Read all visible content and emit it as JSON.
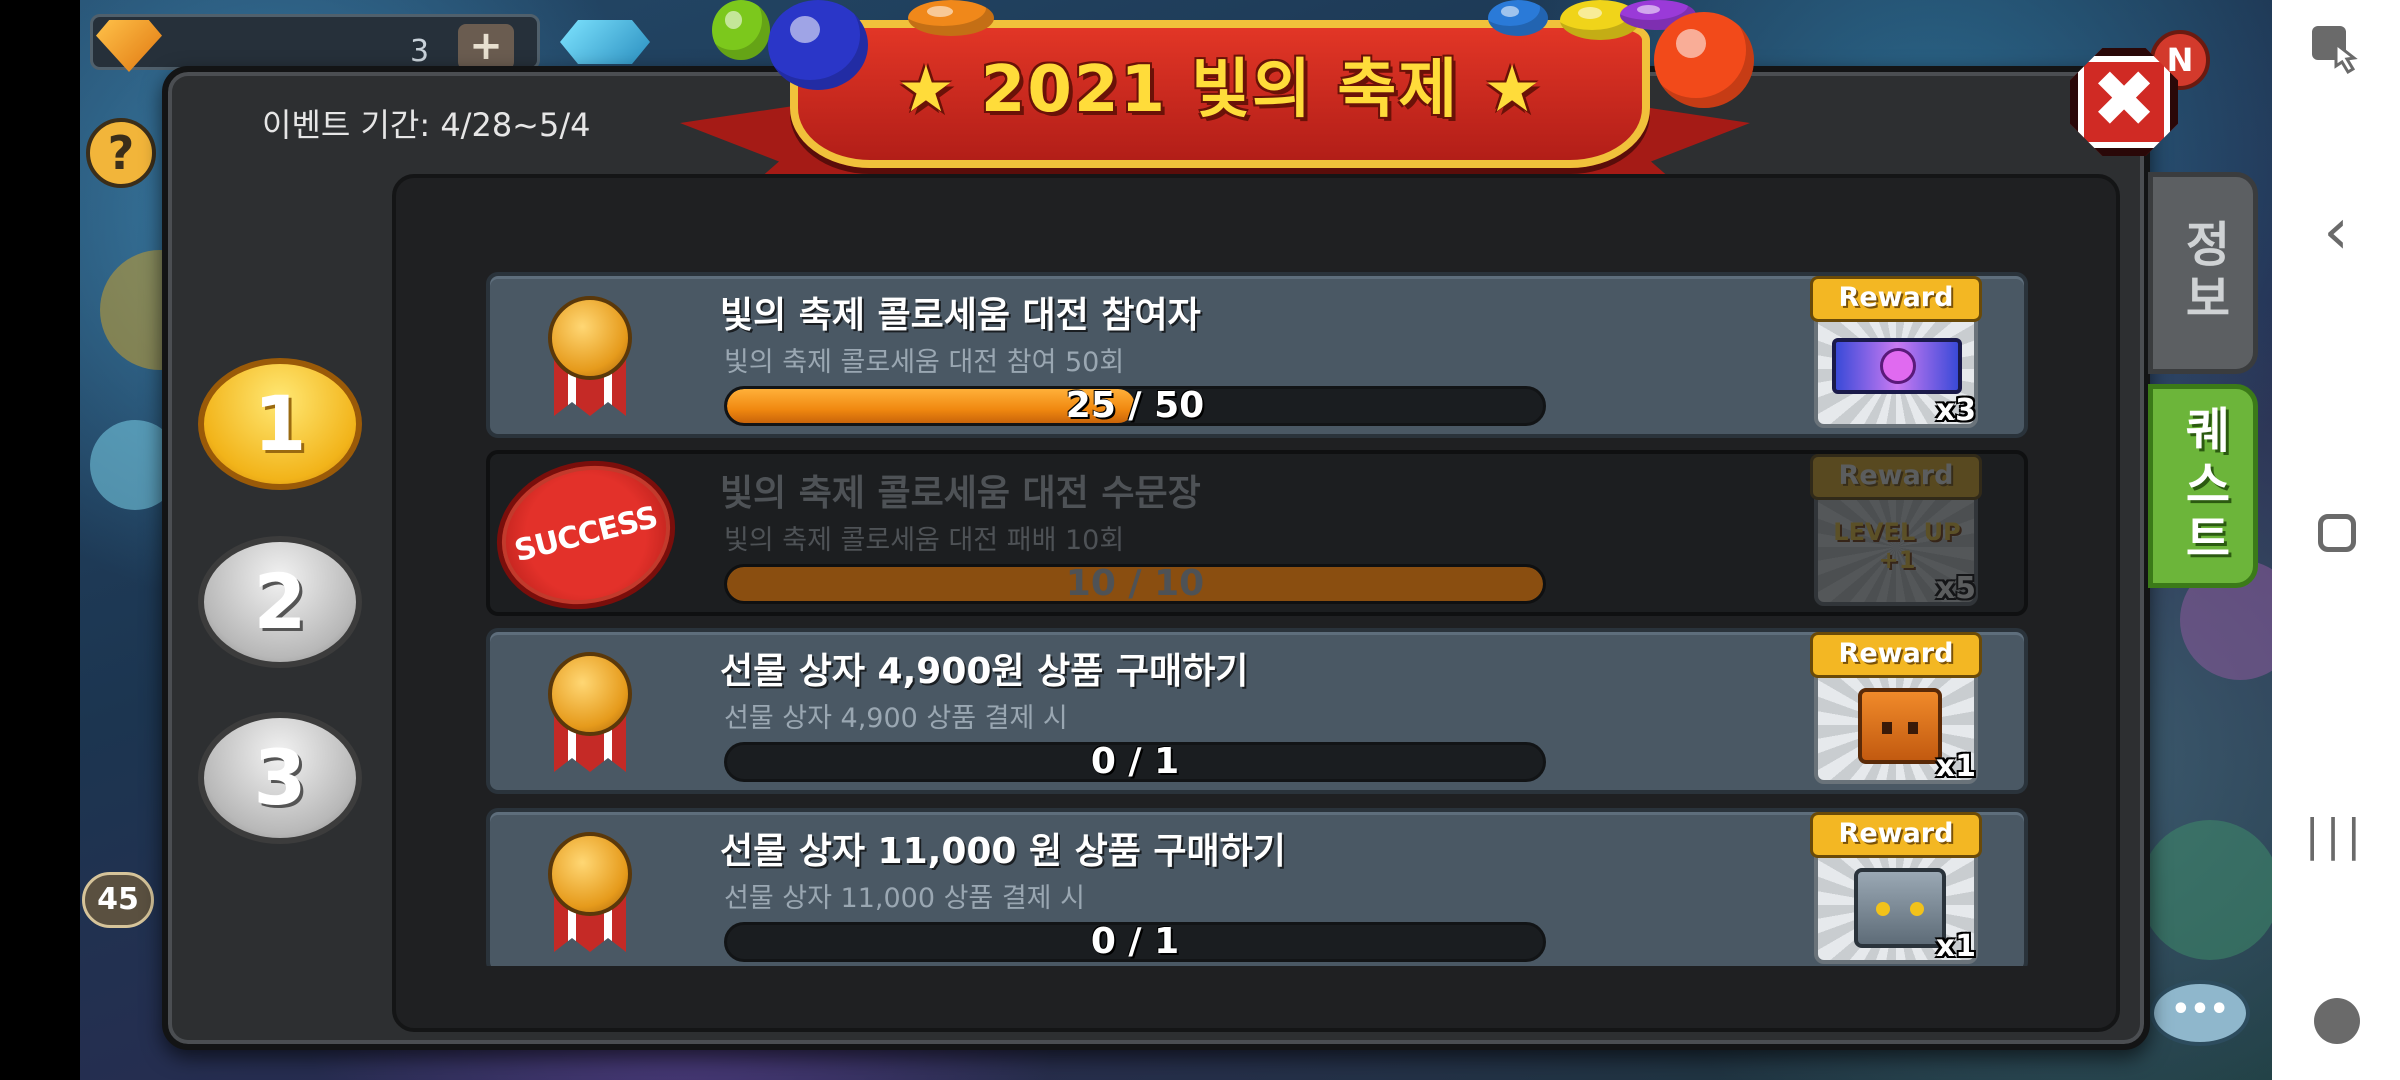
{
  "game": {
    "gem_count": "3",
    "gem_plus": "+",
    "help_symbol": "?",
    "level": "45",
    "notice_badge": "N",
    "chat_symbol": "•••"
  },
  "dialog": {
    "banner_title": "★ 2021 빛의 축제 ★",
    "event_period": "이벤트 기간: 4/28~5/4",
    "close_symbol": "✖",
    "tabs": [
      {
        "label": "정보",
        "active": false
      },
      {
        "label": "퀘스트",
        "active": true
      }
    ],
    "steps": [
      {
        "label": "1",
        "active": true
      },
      {
        "label": "2",
        "active": false
      },
      {
        "label": "3",
        "active": false
      }
    ],
    "quests": [
      {
        "title": "빛의 축제 콜로세움 대전 참여자",
        "subtitle": "빛의 축제 콜로세움 대전 참여 50회",
        "progress_text": "25 / 50",
        "progress": 0.5,
        "reward_label": "Reward",
        "reward_qty": "x3",
        "reward_icon": "ticket-icon",
        "completed": false
      },
      {
        "title": "빛의 축제 콜로세움 대전 수문장",
        "subtitle": "빛의 축제 콜로세움 대전 패배 10회",
        "progress_text": "10 / 10",
        "progress": 1.0,
        "reward_label": "Reward",
        "reward_qty": "x5",
        "reward_icon": "level-up-icon",
        "reward_art_text": "LEVEL UP +1",
        "completed": true,
        "stamp": "SUCCESS"
      },
      {
        "title": "선물 상자 4,900원 상품 구매하기",
        "subtitle": "선물 상자 4,900 상품 결제 시",
        "progress_text": "0 / 1",
        "progress": 0,
        "reward_label": "Reward",
        "reward_qty": "x1",
        "reward_icon": "orange-box-icon",
        "completed": false
      },
      {
        "title": "선물 상자 11,000 원 상품 구매하기",
        "subtitle": "선물 상자 11,000 상품 결제 시",
        "progress_text": "0 / 1",
        "progress": 0,
        "reward_label": "Reward",
        "reward_qty": "x1",
        "reward_icon": "robot-box-icon",
        "completed": false
      }
    ]
  },
  "navbar": {
    "touch_icon": "touch-icon",
    "back_icon": "‹",
    "recent_icon": "|||",
    "game_icon": "game-controller-icon"
  },
  "colors": {
    "banner_red": "#d0281f",
    "banner_gold": "#f1c13b",
    "progress_orange": "#f08810",
    "quest_tab_green": "#6cb53a",
    "reward_yellow": "#f3b723"
  }
}
